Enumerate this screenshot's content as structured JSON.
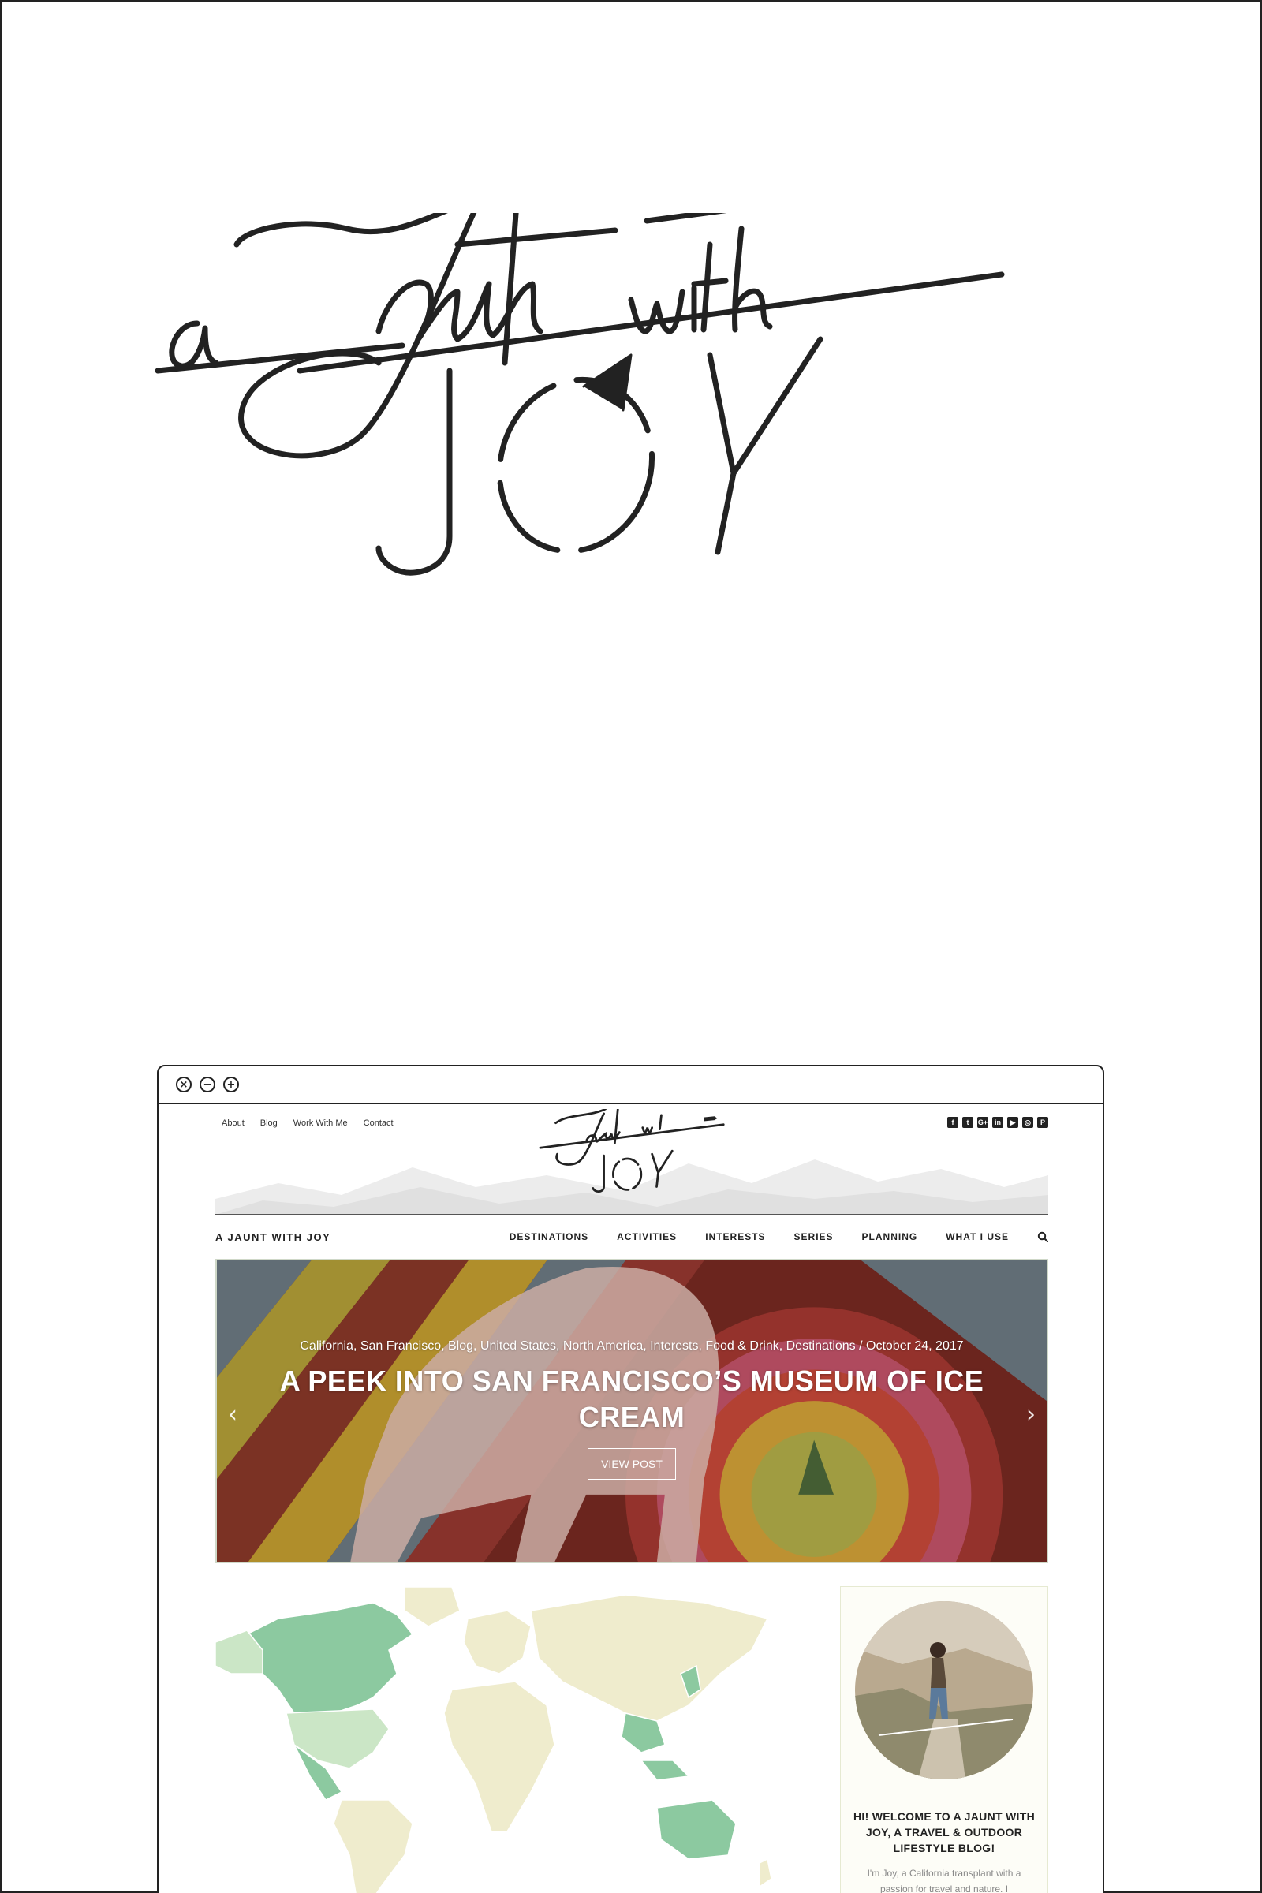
{
  "brand": {
    "logo_text": "a Jaunt with JOY"
  },
  "window": {
    "controls": [
      "close",
      "minimize",
      "maximize"
    ],
    "close_glyph": "×",
    "minimize_glyph": "−",
    "maximize_glyph": "+"
  },
  "site": {
    "top_links": [
      "About",
      "Blog",
      "Work With Me",
      "Contact"
    ],
    "social_icons": [
      "facebook-icon",
      "twitter-icon",
      "google-plus-icon",
      "linkedin-icon",
      "youtube-icon",
      "instagram-icon",
      "pinterest-icon"
    ],
    "social_glyphs": [
      "f",
      "t",
      "G+",
      "in",
      "▶",
      "◎",
      "P"
    ],
    "brand_text": "A JAUNT WITH JOY",
    "menu": [
      "DESTINATIONS",
      "ACTIVITIES",
      "INTERESTS",
      "SERIES",
      "PLANNING",
      "WHAT I USE"
    ],
    "hero": {
      "meta": "California, San Francisco, Blog, United States, North America, Interests, Food & Drink, Destinations / October 24, 2017",
      "title": "A PEEK INTO SAN FRANCISCO’S MUSEUM OF ICE CREAM",
      "button": "VIEW POST",
      "prev": "‹",
      "next": "›"
    },
    "sidebar": {
      "welcome": "HI! WELCOME TO A JAUNT WITH JOY, A TRAVEL & OUTDOOR LIFESTYLE BLOG!",
      "intro": "I'm Joy, a California transplant with a passion for travel and nature. I"
    }
  },
  "colors": {
    "map_visited": "#8cc9a0",
    "map_light": "#cbe6c6",
    "map_unvisited": "#efeccd",
    "border": "#222222"
  }
}
